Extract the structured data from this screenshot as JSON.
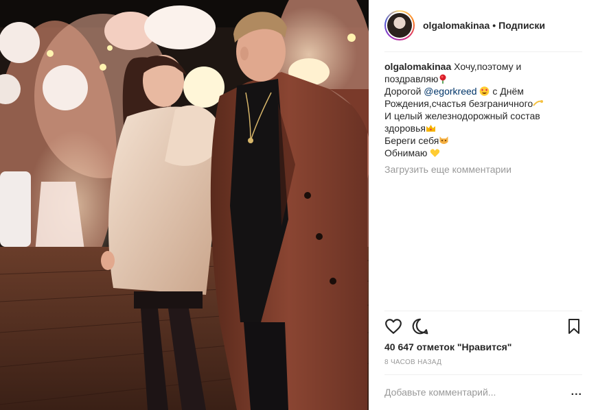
{
  "post": {
    "username": "olgalomakinaa",
    "separator": "•",
    "follow_label": "Подписки"
  },
  "caption": {
    "username": "olgalomakinaa",
    "line1": "Хочу,поэтому и",
    "line2": "поздравляю",
    "line3_start": "Дорогой",
    "mention": "@egorkreed",
    "line3_end": "с Днём",
    "line4": "Рождения,счастья безграничного",
    "line5": "И целый железнодорожный состав",
    "line6": "здоровья",
    "line7": "Береги себя",
    "line8": "Обнимаю"
  },
  "comments": {
    "load_more": "Загрузить еще комментарии",
    "placeholder": "Добавьте комментарий...",
    "more_options": "..."
  },
  "stats": {
    "likes": "40 647 отметок \"Нравится\"",
    "time": "8 ЧАСОВ НАЗАД"
  },
  "icons": {
    "like": "heart-icon",
    "comment": "speech-bubble-icon",
    "save": "bookmark-icon"
  },
  "colors": {
    "mention": "#003569",
    "muted": "#999999",
    "text": "#262626"
  }
}
